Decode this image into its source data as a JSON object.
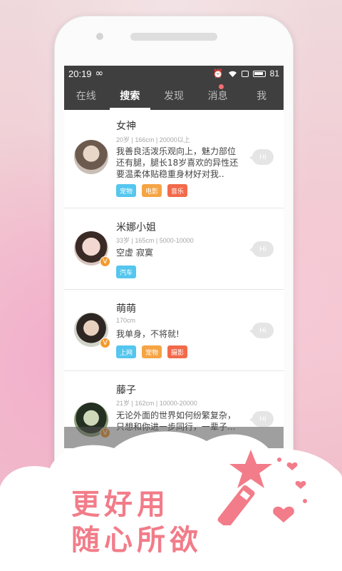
{
  "status_bar": {
    "time": "20:19",
    "battery": "81"
  },
  "tabs": [
    {
      "label": "在线"
    },
    {
      "label": "搜索"
    },
    {
      "label": "发现"
    },
    {
      "label": "消息"
    },
    {
      "label": "我"
    }
  ],
  "users": [
    {
      "name": "女神",
      "meta": "20岁 | 166cm | 20000以上",
      "desc": "我善良活泼乐观向上，魅力部位还有腿，腿长18岁喜欢的异性还要温柔体贴稳重身材好对我..",
      "tags": [
        {
          "label": "宠物",
          "color": "#55c6ee"
        },
        {
          "label": "电影",
          "color": "#f5a444"
        },
        {
          "label": "音乐",
          "color": "#f26a4a"
        }
      ],
      "hi": "Hi"
    },
    {
      "name": "米娜小姐",
      "meta": "33岁 | 165cm | 5000-10000",
      "desc": "空虚  寂寞",
      "tags": [
        {
          "label": "汽车",
          "color": "#55c6ee"
        }
      ],
      "hi": "Hi"
    },
    {
      "name": "萌萌",
      "meta": "170cm",
      "desc": "我单身，不将就!",
      "tags": [
        {
          "label": "上网",
          "color": "#55c6ee"
        },
        {
          "label": "宠物",
          "color": "#f5a444"
        },
        {
          "label": "摄影",
          "color": "#f26a4a"
        }
      ],
      "hi": "Hi"
    },
    {
      "name": "藤子",
      "meta": "21岁 | 162cm | 10000-20000",
      "desc": "无论外面的世界如何纷繁复杂，只想和你进一步同行，一辈子...",
      "tags": [],
      "hi": "Hi"
    }
  ],
  "slogan": {
    "line1": "更好用",
    "line2": "随心所欲"
  },
  "colors": {
    "accent": "#f27c89",
    "tab_bar": "#3f3f3f",
    "badge": "#f29a2e"
  }
}
